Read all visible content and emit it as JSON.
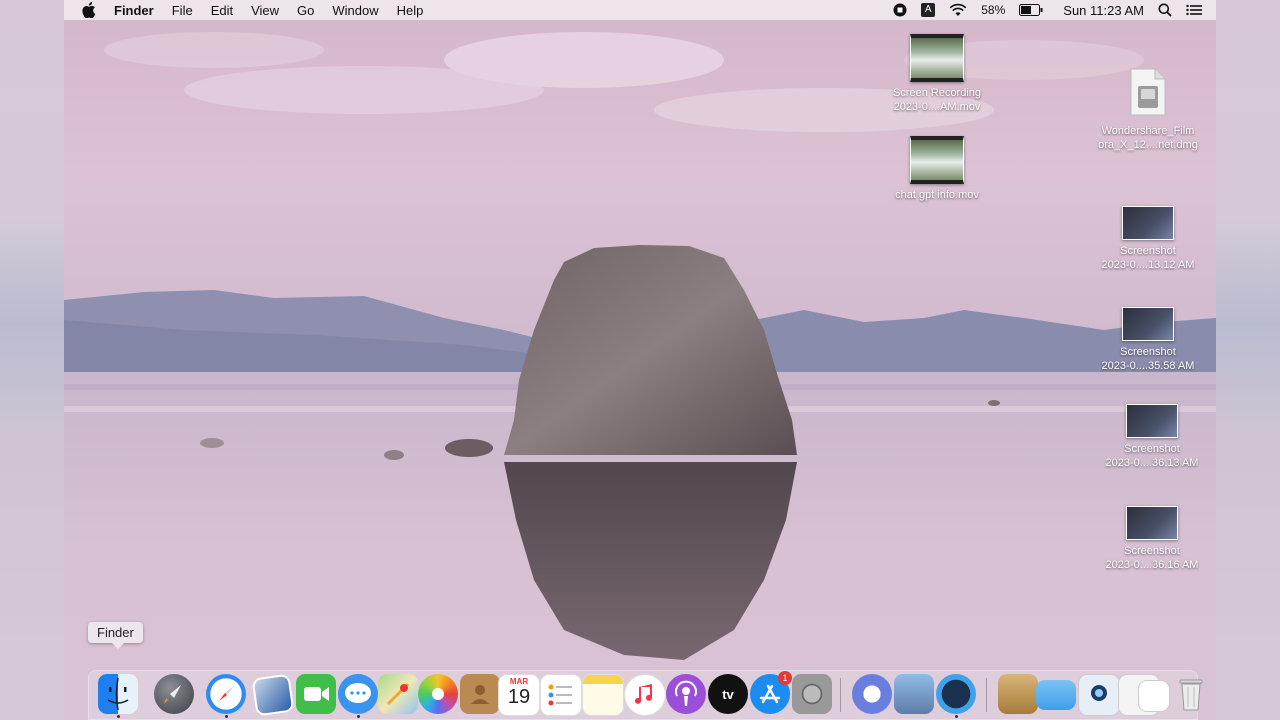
{
  "menubar": {
    "app_name": "Finder",
    "menus": [
      "File",
      "Edit",
      "View",
      "Go",
      "Window",
      "Help"
    ],
    "battery": "58%",
    "clock": "Sun 11:23 AM",
    "input_source": "A"
  },
  "desktop_icons": [
    {
      "line1": "Screen Recording",
      "line2": "2023-0....AM.mov"
    },
    {
      "line1": "chat gpt info.mov",
      "line2": ""
    },
    {
      "line1": "Wondershare_Film",
      "line2": "ora_X_12....net.dmg"
    },
    {
      "line1": "Screenshot",
      "line2": "2023-0....13.12 AM"
    },
    {
      "line1": "Screenshot",
      "line2": "2023-0....35.58 AM"
    },
    {
      "line1": "Screenshot",
      "line2": "2023-0....36.13 AM"
    },
    {
      "line1": "Screenshot",
      "line2": "2023-0....36.16 AM"
    }
  ],
  "tooltip": "Finder",
  "dock": {
    "calendar_month": "MAR",
    "calendar_day": "19",
    "appstore_badge": "1",
    "tv_label": "tv"
  }
}
